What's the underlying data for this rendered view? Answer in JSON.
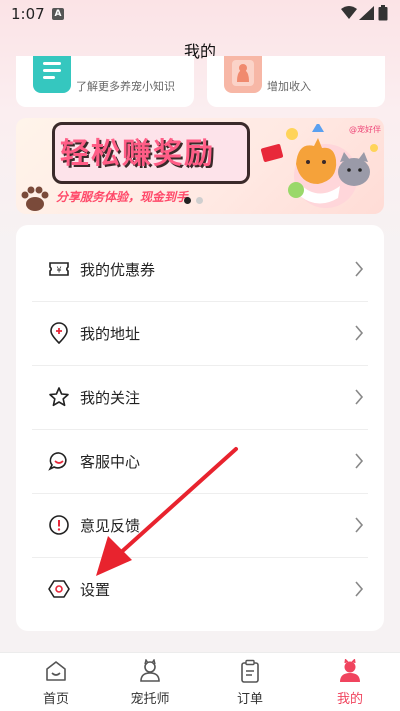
{
  "status_bar": {
    "time": "1:07",
    "notif_badge": "A"
  },
  "header": {
    "title": "我的"
  },
  "service_cards": [
    {
      "subtitle": "了解更多养宠小知识",
      "icon": "knowledge-book-icon",
      "color": "#35c7bf"
    },
    {
      "subtitle": "增加收入",
      "icon": "pet-cat-icon",
      "color": "#f7b7a6"
    }
  ],
  "banner": {
    "title": "轻松赚奖励",
    "subtitle": "分享服务体验，现金到手",
    "tag": "@宠好伴",
    "page_index": 1,
    "page_count": 2
  },
  "menu": {
    "items": [
      {
        "label": "我的优惠券",
        "icon": "coupon-icon"
      },
      {
        "label": "我的地址",
        "icon": "location-pin-icon"
      },
      {
        "label": "我的关注",
        "icon": "star-icon"
      },
      {
        "label": "客服中心",
        "icon": "chat-support-icon"
      },
      {
        "label": "意见反馈",
        "icon": "feedback-exclamation-icon"
      },
      {
        "label": "设置",
        "icon": "settings-hexagon-icon"
      }
    ]
  },
  "tabs": [
    {
      "label": "首页",
      "icon": "home-icon",
      "active": false
    },
    {
      "label": "宠托师",
      "icon": "pet-sitter-icon",
      "active": false
    },
    {
      "label": "订单",
      "icon": "order-clipboard-icon",
      "active": false
    },
    {
      "label": "我的",
      "icon": "profile-icon",
      "active": true
    }
  ],
  "colors": {
    "accent": "#f0445e",
    "teal": "#35c7bf",
    "annotation_arrow": "#e8232e"
  }
}
